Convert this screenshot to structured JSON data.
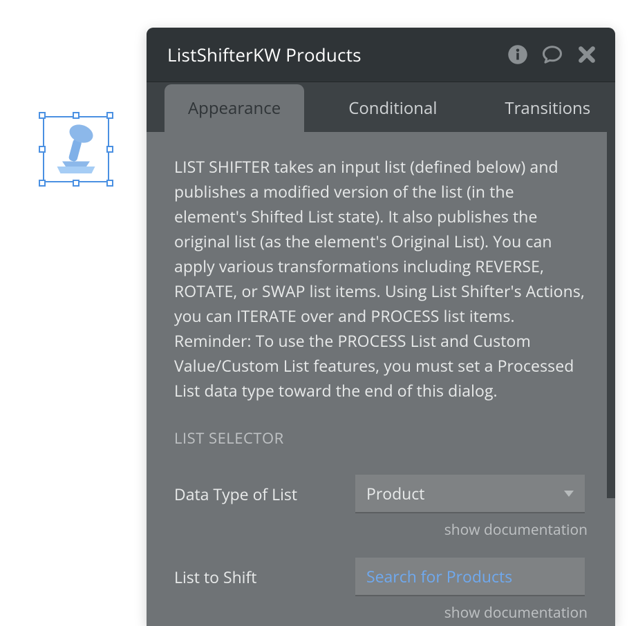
{
  "header": {
    "title": "ListShifterKW Products"
  },
  "tabs": [
    {
      "label": "Appearance",
      "active": true
    },
    {
      "label": "Conditional",
      "active": false
    },
    {
      "label": "Transitions",
      "active": false
    }
  ],
  "appearance": {
    "description": "LIST SHIFTER takes an input list (defined below) and publishes a modified version of the list (in the element's Shifted List state). It also publishes the original list (as the element's Original List). You can apply various transformations including REVERSE, ROTATE, or SWAP list items. Using List Shifter's Actions, you can ITERATE over and PROCESS list items. Reminder: To use the PROCESS List and Custom Value/Custom List features, you must set a Processed List data type toward the end of this dialog.",
    "section_label": "LIST SELECTOR",
    "fields": {
      "data_type": {
        "label": "Data Type of List",
        "value": "Product",
        "doc_link": "show documentation"
      },
      "list_to_shift": {
        "label": "List to Shift",
        "value": "Search for Products",
        "doc_link": "show documentation"
      }
    }
  },
  "icons": {
    "info": "info",
    "comment": "comment",
    "close": "close"
  },
  "colors": {
    "accent": "#4a90e2",
    "panel_bg": "#6f7376",
    "header_bg": "#2f3437",
    "tabs_bg": "#3d4245",
    "link": "#6fa9ef"
  }
}
